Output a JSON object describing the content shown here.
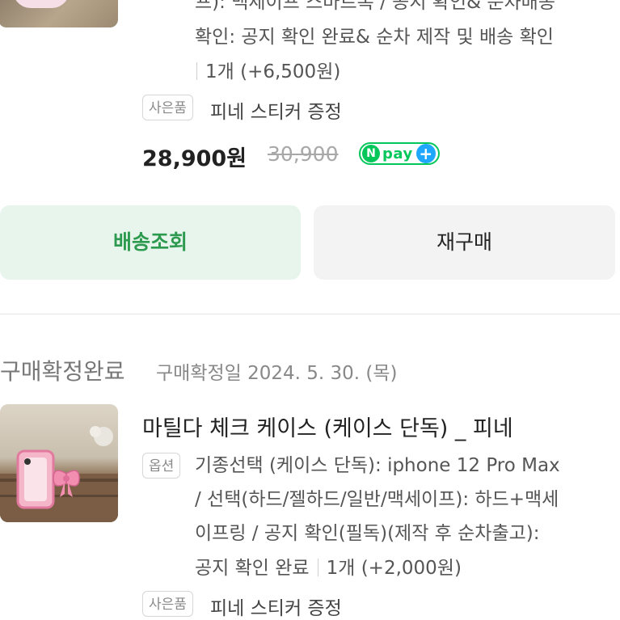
{
  "order1": {
    "option_line1": "프): 맥세이프 스마트톡 / 공지 확인& 순차배송",
    "option_line2": "확인: 공지 확인 완료& 순차 제작 및 배송 확인",
    "quantity": "1개 (+6,500원)",
    "gift_chip": "사은품",
    "gift_text": "피네 스티커 증정",
    "price": "28,900원",
    "original_price": "30,900",
    "npay": {
      "n": "N",
      "pay": "pay",
      "plus": "+"
    },
    "track_button": "배송조회",
    "rebuy_button": "재구매"
  },
  "order2": {
    "status": "구매확정완료",
    "confirm_date": "구매확정일 2024. 5. 30. (목)",
    "product_title": "마틸다 체크 케이스 (케이스 단독) _ 피네",
    "option_chip": "옵션",
    "option_line1": "기종선택 (케이스 단독): iphone 12 Pro Max",
    "option_line2": "/ 선택(하드/젤하드/일반/맥세이프): 하드+맥세",
    "option_line3": "이프링 / 공지 확인(필독)(제작 후 순차출고):",
    "option_line4": "공지 확인 완료",
    "quantity": "1개 (+2,000원)",
    "gift_chip": "사은품",
    "gift_text": "피네 스티커 증정"
  },
  "colors": {
    "accent_green": "#2d9a4f",
    "track_bg": "#e7f5ec",
    "npay_green": "#03c75a",
    "npay_blue": "#1ea7fd"
  }
}
